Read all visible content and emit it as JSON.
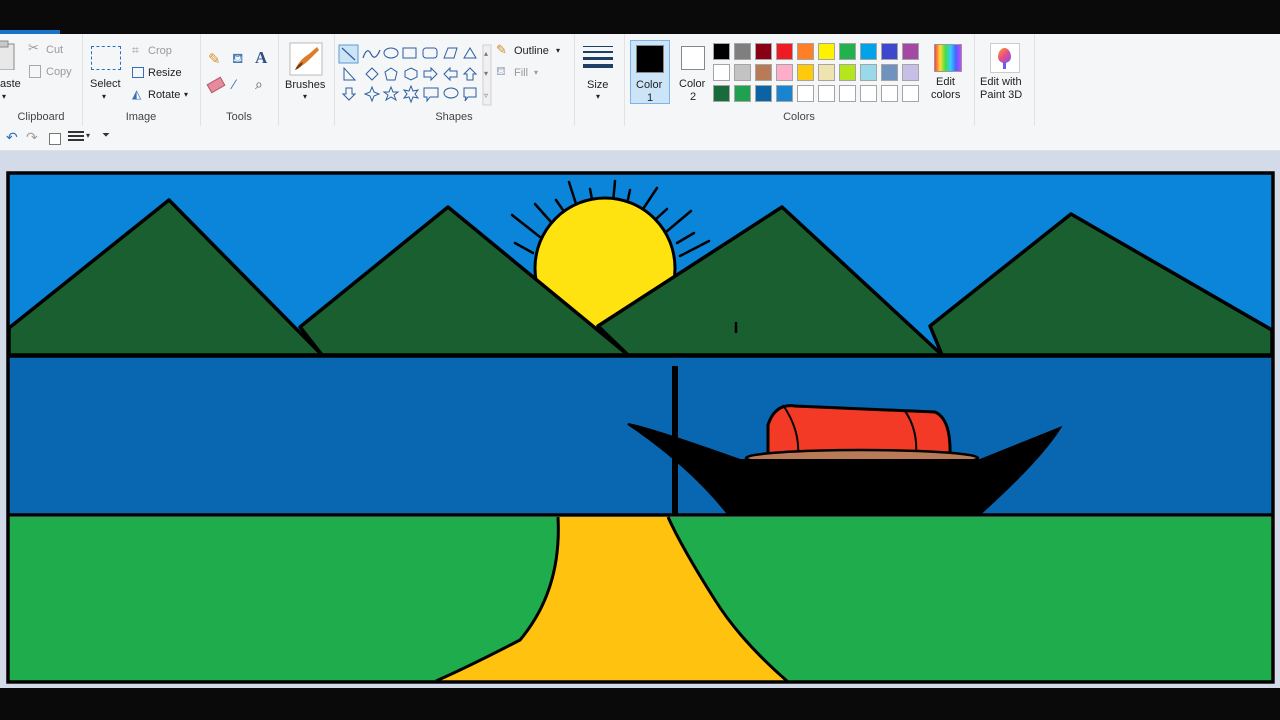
{
  "ribbon": {
    "clipboard": {
      "paste_label": "aste",
      "cut_label": "Cut",
      "copy_label": "Copy",
      "group_label": "Clipboard"
    },
    "image": {
      "select_label": "Select",
      "crop_label": "Crop",
      "resize_label": "Resize",
      "rotate_label": "Rotate",
      "group_label": "Image"
    },
    "tools": {
      "group_label": "Tools"
    },
    "brushes": {
      "label": "Brushes"
    },
    "shapes": {
      "outline_label": "Outline",
      "fill_label": "Fill",
      "group_label": "Shapes"
    },
    "size": {
      "label": "Size"
    },
    "color1": {
      "label_line1": "Color",
      "label_line2": "1",
      "color": "#000000"
    },
    "color2": {
      "label_line1": "Color",
      "label_line2": "2",
      "color": "#ffffff"
    },
    "colors": {
      "group_label": "Colors",
      "palette": [
        "#000000",
        "#7f7f7f",
        "#880015",
        "#ed1c24",
        "#ff7f27",
        "#fff200",
        "#22b14c",
        "#00a2e8",
        "#3f48cc",
        "#a349a4",
        "#ffffff",
        "#c3c3c3",
        "#b97a57",
        "#ffaec9",
        "#ffc90e",
        "#efe4b0",
        "#b5e61d",
        "#99d9ea",
        "#7092be",
        "#c8bfe7",
        "#196b3b",
        "#1fa150",
        "#0a64a4",
        "#1b84d0",
        "#ffffff",
        "#ffffff",
        "#ffffff",
        "#ffffff",
        "#ffffff",
        "#ffffff"
      ]
    },
    "edit_colors": {
      "line1": "Edit",
      "line2": "colors"
    },
    "paint3d": {
      "line1": "Edit with",
      "line2": "Paint 3D"
    }
  },
  "drawing": {
    "sky_color": "#0a85d9",
    "mountain_color": "#1a5f30",
    "river_color": "#0966b0",
    "grass_color": "#1fac4d",
    "path_color": "#ffc20e",
    "sun_color": "#ffe311",
    "boat_cover_color": "#f23a26",
    "boat_deck_color": "#b97a57"
  }
}
